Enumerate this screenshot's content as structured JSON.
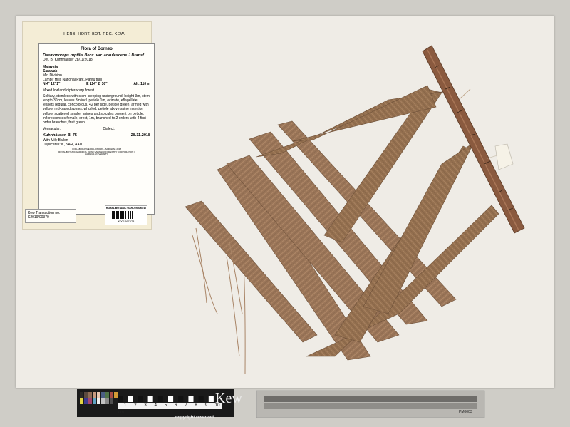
{
  "herbarium_header": "HERB. HORT. BOT. REG. KEW.",
  "flora": "Flora of Borneo",
  "taxon": "Daemonorops ruptilis Becc. var. acaulescens J.Dransf.",
  "determination": "Det.  B. Kuhnhäuser 28/11/2018",
  "country": "Malaysia",
  "state": "Sarawak",
  "division": "Miri Division",
  "locality": "Lambir Hills National Park, Pantu trail",
  "latitude": "N 4° 12' 1\"",
  "longitude": "E 114° 2' 30\"",
  "altitude": "Alt: 110 m",
  "habitat": "Mixed lowland dipterocarp forest",
  "description": "Solitary, stemless with stem creeping underground, height 3m, stem length 30cm, leaves 3m incl. petiole 1m, ecirrate, eflagellate, leaflets regular, concolorous, 42 per side, petiole green, armed with yellow, red-based spines, whorled, petiole above spine insertion yellow, scattered smaller spines and spicules present on petiole, inflorescences female, erect, 1m, branched to 2 orders with 4 first order branches, fruit green",
  "vernacular_label": "Vernacular:",
  "dialect_label": "Dialect:",
  "collector": "Kuhnhäuser, B.",
  "collector_number": "75",
  "collection_date": "28.11.2018",
  "companions": "With Mily Ballon",
  "duplicates": "Duplicates: K, SAR, AAU",
  "footer_line1": "COLLABORATIVE FIELDWORK – SARAWAK 2018",
  "footer_line2": "ROYAL BOTANIC GARDENS, KEW | SARAWAK FORESTRY CORPORATION |",
  "footer_line3": "AARHUS UNIVERSITY",
  "transaction_label": "Kew Transaction no.",
  "transaction_no": "K2019/00370",
  "barcode_title": "ROYAL BOTANIC GARDENS KEW",
  "barcode_number": "K001267378",
  "scale_label": "cm",
  "scale_numbers": [
    "1",
    "2",
    "3",
    "4",
    "5",
    "6",
    "7",
    "8",
    "9",
    "10"
  ],
  "copyright": "copyright reserved",
  "kew_logo": "Kew",
  "ruler_id": "PM0003",
  "colors": {
    "sheet": "#efece6",
    "background": "#cfcdc7",
    "leaf": "#9a7558",
    "leaf_dark": "#7a5a42",
    "rachis": "#8a5a3f"
  },
  "color_swatches": [
    "#2c2a28",
    "#5b4a3f",
    "#8f6d57",
    "#c79a80",
    "#e9c8b3",
    "#4b5e83",
    "#4f7448",
    "#a84d44",
    "#d39b35",
    "#e2d443",
    "#3c3a90",
    "#a2456e",
    "#5fa3c3",
    "#efefef",
    "#c3c3c3",
    "#8a8a8a",
    "#4f4f4f",
    "#1c1c1c"
  ]
}
